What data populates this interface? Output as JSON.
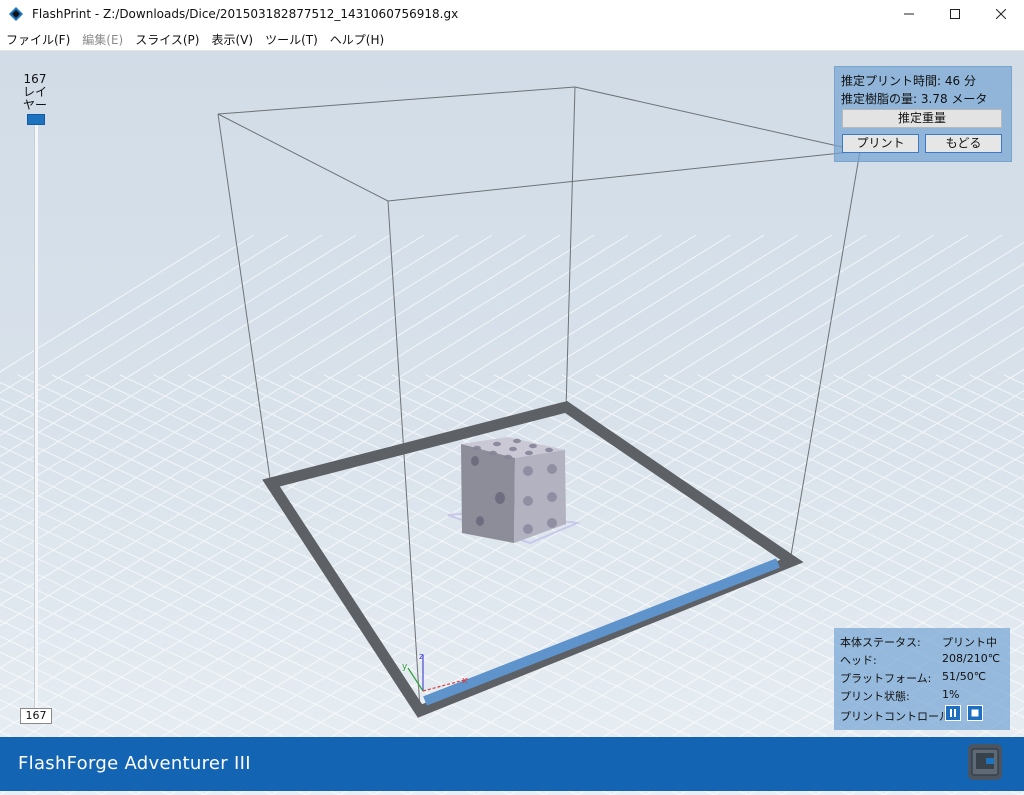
{
  "window": {
    "title": "FlashPrint - Z:/Downloads/Dice/201503182877512_1431060756918.gx",
    "controls": [
      "minimize-icon",
      "maximize-icon",
      "close-icon"
    ]
  },
  "menu": {
    "items": [
      {
        "label": "ファイル(F)",
        "enabled": true
      },
      {
        "label": "編集(E)",
        "enabled": false
      },
      {
        "label": "スライス(P)",
        "enabled": true
      },
      {
        "label": "表示(V)",
        "enabled": true
      },
      {
        "label": "ツール(T)",
        "enabled": true
      },
      {
        "label": "ヘルプ(H)",
        "enabled": true
      }
    ]
  },
  "layer": {
    "count_top": "167",
    "caption_1": "レイ",
    "caption_2": "ヤー",
    "value": "167"
  },
  "estimate": {
    "time_line": "推定プリント時間: 46 分",
    "resin_line": "推定樹脂の量: 3.78 メータ",
    "weight_button": "推定重量",
    "print_button": "プリント",
    "back_button": "もどる"
  },
  "status": {
    "rows": [
      {
        "key": "本体ステータス:",
        "value": "プリント中"
      },
      {
        "key": "ヘッド:",
        "value": "208/210℃"
      },
      {
        "key": "プラットフォーム:",
        "value": "51/50℃"
      },
      {
        "key": "プリント状態:",
        "value": "1%"
      }
    ],
    "control_label": "プリントコントロール:",
    "control_buttons": [
      "pause-icon",
      "stop-icon"
    ]
  },
  "footer": {
    "printer_name": "FlashForge Adventurer III"
  },
  "axes": {
    "x": "x",
    "y": "y",
    "z": "z"
  },
  "colors": {
    "accent": "#1464b4",
    "panel": "#74a4d3",
    "bed_frame": "#5d6064",
    "bed_front": "#5f93cb",
    "dice": "#b6b5c4"
  }
}
